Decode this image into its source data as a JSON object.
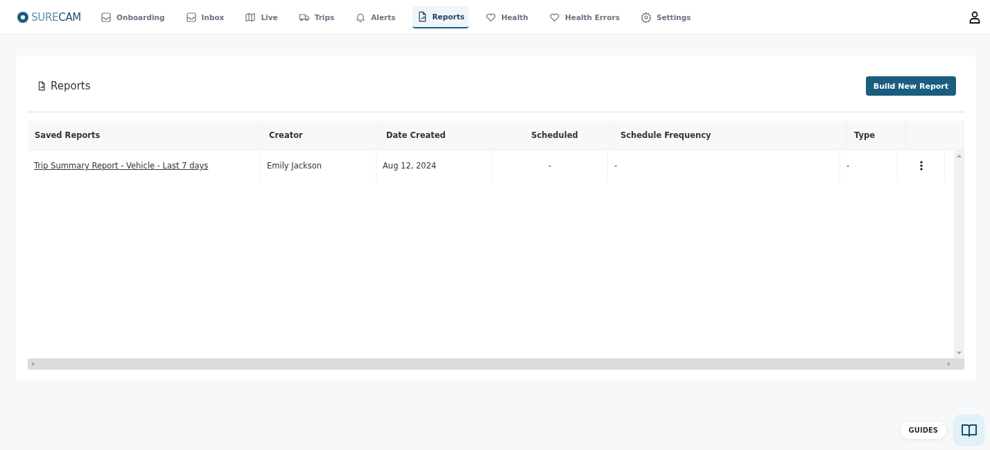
{
  "logo": [
    "SURE",
    "CAM"
  ],
  "nav": [
    {
      "label": "Onboarding",
      "selected": false
    },
    {
      "label": "Inbox",
      "selected": false
    },
    {
      "label": "Live",
      "selected": false
    },
    {
      "label": "Trips",
      "selected": false
    },
    {
      "label": "Alerts",
      "selected": false
    },
    {
      "label": "Reports",
      "selected": true
    },
    {
      "label": "Health",
      "selected": false
    },
    {
      "label": "Health Errors",
      "selected": false
    },
    {
      "label": "Settings",
      "selected": false
    }
  ],
  "page_title": "Reports",
  "build_button": "Build New Report",
  "table": {
    "columns": [
      "Saved Reports",
      "Creator",
      "Date Created",
      "Scheduled",
      "Schedule Frequency",
      "Type"
    ],
    "rows": [
      {
        "cells": [
          "Trip Summary Report - Vehicle - Last 7 days",
          "Emily Jackson",
          "Aug 12, 2024",
          "-",
          "-",
          "-"
        ]
      }
    ]
  },
  "guides": "GUIDES"
}
